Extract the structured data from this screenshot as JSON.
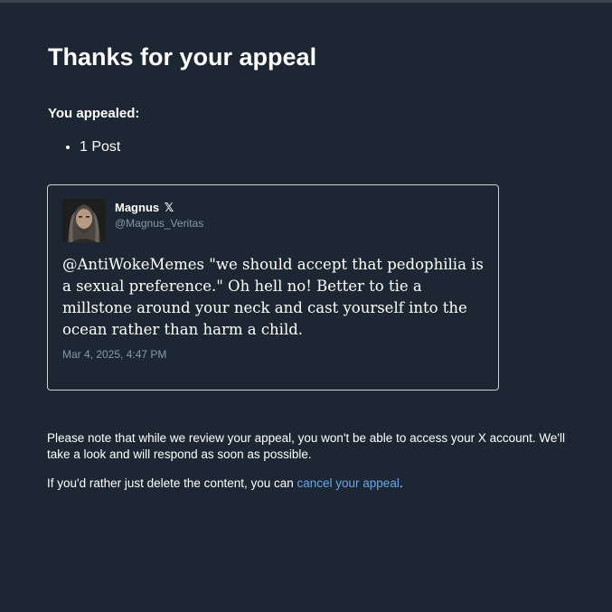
{
  "page": {
    "title": "Thanks for your appeal",
    "subtitle": "You appealed:",
    "appeal_items": [
      "1 Post"
    ]
  },
  "post": {
    "author_name": "Magnus",
    "author_badge": "𝕏",
    "author_handle": "@Magnus_Veritas",
    "text": "@AntiWokeMemes \"we should accept that pedophilia is a sexual preference.\" Oh hell no! Better to tie a millstone around your neck and cast yourself into the ocean rather than harm a child.",
    "date": "Mar 4, 2025, 4:47 PM"
  },
  "footer": {
    "note": "Please note that while we review your appeal, you won't be able to access your X account. We'll take a look and will respond as soon as possible.",
    "cancel_prefix": "If you'd rather just delete the content, you can ",
    "cancel_link": "cancel your appeal",
    "cancel_suffix": "."
  },
  "colors": {
    "background": "#1c2733",
    "link": "#6aa6e8",
    "muted": "#8b98a5",
    "card_border": "#c9d1d9"
  }
}
